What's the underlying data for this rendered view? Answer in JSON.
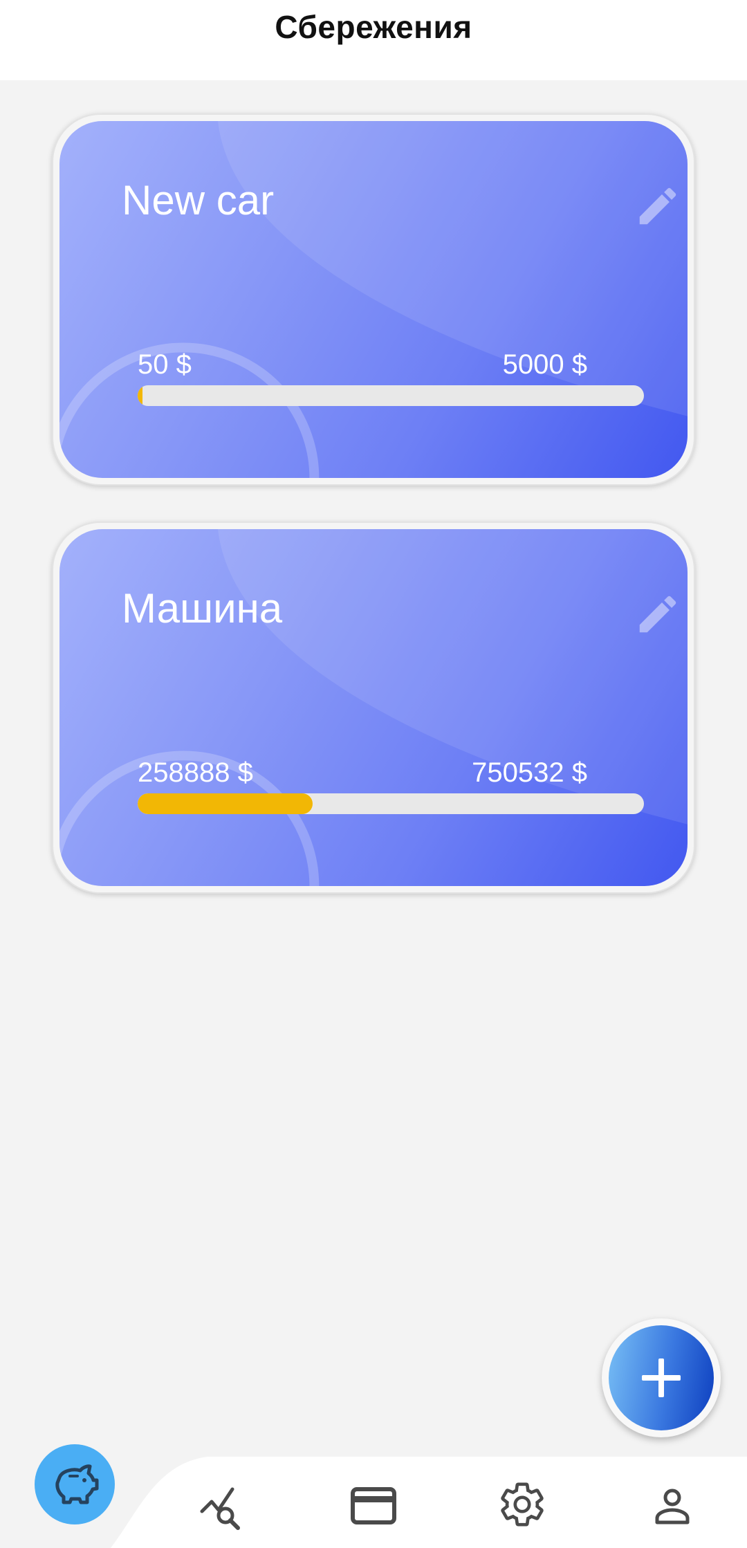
{
  "header": {
    "title": "Сбережения"
  },
  "goals": [
    {
      "title": "New car",
      "saved": "50  $",
      "target": "5000  $",
      "progress": 0.01,
      "edit_icon": "pencil-icon"
    },
    {
      "title": "Машина",
      "saved": "258888  $",
      "target": "750532  $",
      "progress": 0.345,
      "edit_icon": "pencil-icon"
    }
  ],
  "colors": {
    "card_gradient_start": "#a3b1fb",
    "card_gradient_end": "#4258f0",
    "progress_fill": "#f2b705",
    "progress_track": "#e8e8e8",
    "nav_active": "#4aaef4",
    "fab_gradient_start": "#78bff5",
    "fab_gradient_end": "#0d3fbf"
  },
  "fab": {
    "icon": "plus-icon"
  },
  "nav": {
    "items": [
      {
        "name": "savings",
        "icon": "piggy-bank-icon",
        "active": true
      },
      {
        "name": "analytics",
        "icon": "chart-search-icon",
        "active": false
      },
      {
        "name": "cards",
        "icon": "credit-card-icon",
        "active": false
      },
      {
        "name": "settings",
        "icon": "gear-icon",
        "active": false
      },
      {
        "name": "profile",
        "icon": "person-icon",
        "active": false
      }
    ]
  }
}
